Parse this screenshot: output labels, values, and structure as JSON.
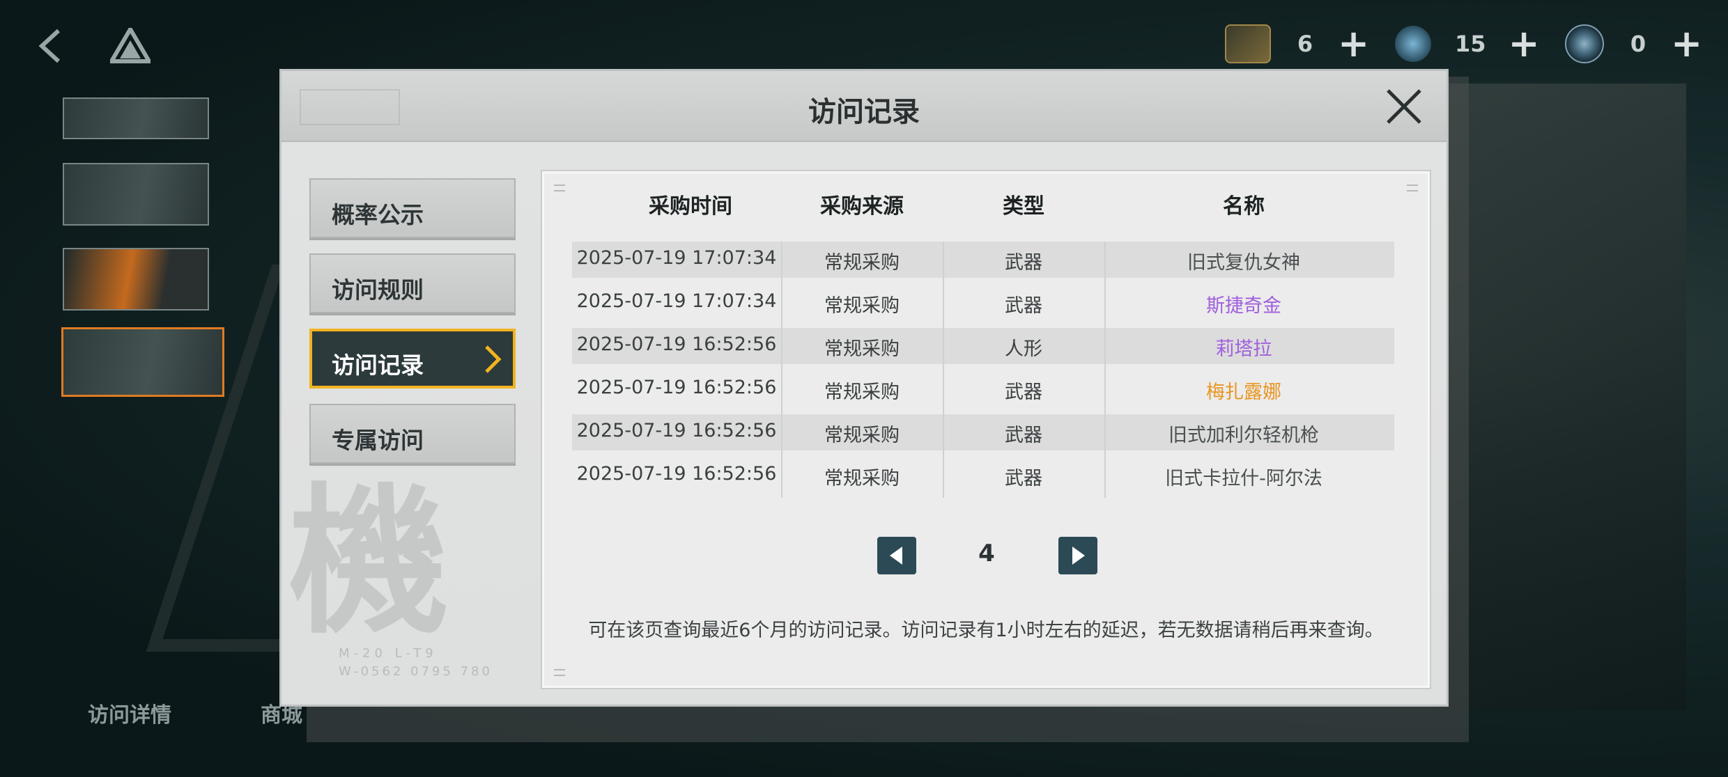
{
  "topbar": {
    "currencies": [
      {
        "icon": "ticket-icon",
        "count": "6",
        "plus": "+"
      },
      {
        "icon": "crystal-icon",
        "count": "15",
        "plus": "+"
      },
      {
        "icon": "coin-icon",
        "count": "0",
        "plus": "+"
      }
    ]
  },
  "bottom_tabs": [
    "访问详情",
    "商城"
  ],
  "dialog": {
    "title": "访问记录",
    "menu": [
      {
        "label": "概率公示",
        "active": false
      },
      {
        "label": "访问规则",
        "active": false
      },
      {
        "label": "访问记录",
        "active": true
      },
      {
        "label": "专属访问",
        "active": false
      }
    ],
    "watermark": "機",
    "watermark_sub1": "M-20 L-T9",
    "watermark_sub2": "W-0562 0795 780",
    "table": {
      "headers": [
        "采购时间",
        "采购来源",
        "类型",
        "名称"
      ],
      "rows": [
        {
          "time": "2025-07-19 17:07:34",
          "source": "常规采购",
          "type": "武器",
          "name": "旧式复仇女神",
          "rarity_color": "#4a4f50"
        },
        {
          "time": "2025-07-19 17:07:34",
          "source": "常规采购",
          "type": "武器",
          "name": "斯捷奇金",
          "rarity_color": "#a05fdc"
        },
        {
          "time": "2025-07-19 16:52:56",
          "source": "常规采购",
          "type": "人形",
          "name": "莉塔拉",
          "rarity_color": "#a05fdc"
        },
        {
          "time": "2025-07-19 16:52:56",
          "source": "常规采购",
          "type": "武器",
          "name": "梅扎露娜",
          "rarity_color": "#e8951f"
        },
        {
          "time": "2025-07-19 16:52:56",
          "source": "常规采购",
          "type": "武器",
          "name": "旧式加利尔轻机枪",
          "rarity_color": "#4a4f50"
        },
        {
          "time": "2025-07-19 16:52:56",
          "source": "常规采购",
          "type": "武器",
          "name": "旧式卡拉什-阿尔法",
          "rarity_color": "#4a4f50"
        }
      ]
    },
    "pager": {
      "page": "4"
    },
    "note": "可在该页查询最近6个月的访问记录。访问记录有1小时左右的延迟，若无数据请稍后再来查询。"
  },
  "colors": {
    "accent_border": "#f2b320",
    "active_bg": "#2c3a3c",
    "pager_btn": "#2b4a55",
    "purple_rarity": "#a05fdc",
    "orange_rarity": "#e8951f"
  }
}
